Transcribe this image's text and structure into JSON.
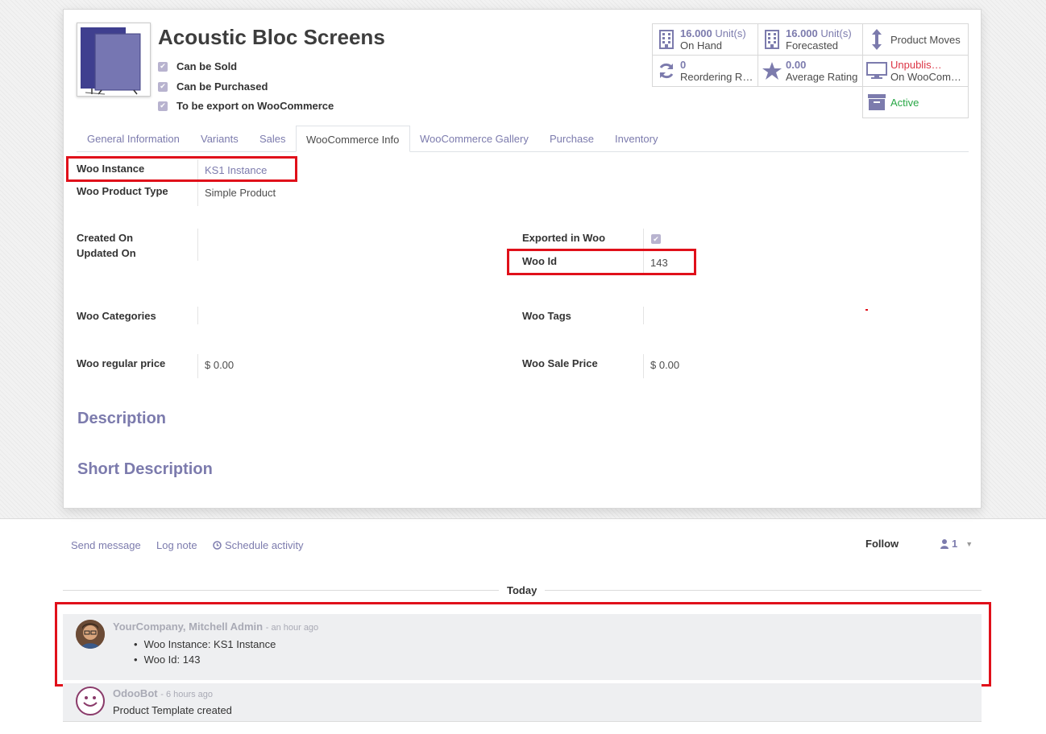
{
  "product": {
    "name": "Acoustic Bloc Screens",
    "can_be_sold": "Can be Sold",
    "can_be_purchased": "Can be Purchased",
    "export_woo": "To be export on WooCommerce"
  },
  "stats": {
    "on_hand_value": "16.000",
    "on_hand_unit": "Unit(s)",
    "on_hand_label": "On Hand",
    "forecast_value": "16.000",
    "forecast_unit": "Unit(s)",
    "forecast_label": "Forecasted",
    "product_moves": "Product Moves",
    "reordering_value": "0",
    "reordering_label": "Reordering R…",
    "rating_value": "0.00",
    "rating_label": "Average Rating",
    "unpublish_label": "Unpublis…",
    "unpublish_sub": "On WooCom…",
    "active_label": "Active"
  },
  "tabs": [
    "General Information",
    "Variants",
    "Sales",
    "WooCommerce Info",
    "WooCommerce Gallery",
    "Purchase",
    "Inventory"
  ],
  "fields": {
    "woo_instance_label": "Woo Instance",
    "woo_instance_value": "KS1 Instance",
    "woo_product_type_label": "Woo Product Type",
    "woo_product_type_value": "Simple Product",
    "created_on_label": "Created On",
    "updated_on_label": "Updated On",
    "exported_label": "Exported in Woo",
    "woo_id_label": "Woo Id",
    "woo_id_value": "143",
    "woo_categories_label": "Woo Categories",
    "woo_tags_label": "Woo Tags",
    "regular_price_label": "Woo regular price",
    "regular_price_value": "$ 0.00",
    "sale_price_label": "Woo Sale Price",
    "sale_price_value": "$ 0.00",
    "description_title": "Description",
    "short_description_title": "Short Description"
  },
  "chatter": {
    "send_message": "Send message",
    "log_note": "Log note",
    "schedule_activity": "Schedule activity",
    "follow": "Follow",
    "followers_count": "1",
    "today": "Today",
    "messages": [
      {
        "author": "YourCompany, Mitchell Admin",
        "date": "- an hour ago",
        "lines": [
          "Woo Instance: KS1 Instance",
          "Woo Id: 143"
        ]
      },
      {
        "author": "OdooBot",
        "date": "- 6 hours ago",
        "body": "Product Template created"
      }
    ]
  },
  "colors": {
    "accent": "#7c7bad",
    "highlight_box": "#e0101a",
    "active": "#28a745",
    "unpublish": "#dc3545"
  }
}
